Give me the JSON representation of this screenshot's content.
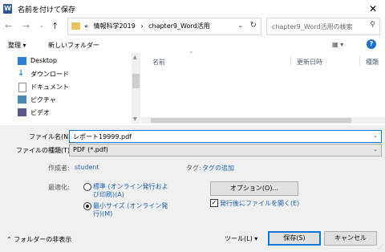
{
  "window": {
    "title": "名前を付けて保存",
    "app_icon_letter": "W",
    "close_glyph": "✕"
  },
  "address_bar": {
    "back_glyph": "←",
    "forward_glyph": "→",
    "history_glyph": "⌄",
    "up_glyph": "↑",
    "overflow": "«",
    "path": [
      "情報科学2019",
      "chapter9_Word活用"
    ],
    "separator": "›",
    "dropdown_glyph": "⌄",
    "refresh_glyph": "↻"
  },
  "search": {
    "placeholder": "chapter9_Word活用の検索",
    "icon_glyph": "⚲"
  },
  "toolbar": {
    "organize_label": "整理 ▾",
    "new_folder_label": "新しいフォルダー",
    "view_glyph": "▦ ▾",
    "help_glyph": "?"
  },
  "nav_pane": {
    "items": [
      {
        "label": "Desktop",
        "icon": "desktop-icon",
        "color": "#2d7fd3"
      },
      {
        "label": "ダウンロード",
        "icon": "download-icon",
        "color": "#2d7fd3"
      },
      {
        "label": "ドキュメント",
        "icon": "documents-icon",
        "color": "#8a8a8a"
      },
      {
        "label": "ピクチャ",
        "icon": "pictures-icon",
        "color": "#4a8ab8"
      },
      {
        "label": "ビデオ",
        "icon": "videos-icon",
        "color": "#5a5a8a"
      }
    ]
  },
  "file_list": {
    "columns": {
      "name": "名前",
      "date": "更新日時",
      "type": "種類"
    },
    "sort_glyph": "^"
  },
  "form": {
    "filename_label": "ファイル名(N):",
    "filename_value": "レポート19999.pdf",
    "filetype_label": "ファイルの種類(T):",
    "filetype_value": "PDF (*.pdf)",
    "author_label": "作成者:",
    "author_value": "student",
    "tags_label": "タグ:",
    "tags_value": "タグの追加",
    "optimize_label": "最適化:",
    "opt_standard_line1": "標準 (オンライン発行およ",
    "opt_standard_line2": "び印刷)(A)",
    "opt_minimum_line1": "最小サイズ (オンライン発",
    "opt_minimum_line2": "行)(M)",
    "options_button": "オプション(O)...",
    "open_after_label": "発行後にファイルを開く(E)",
    "open_after_checked": true
  },
  "footer": {
    "hide_folders_label": "フォルダーの非表示",
    "tools_label": "ツール(L)",
    "save_label": "保存(S)",
    "cancel_label": "キャンセル"
  }
}
